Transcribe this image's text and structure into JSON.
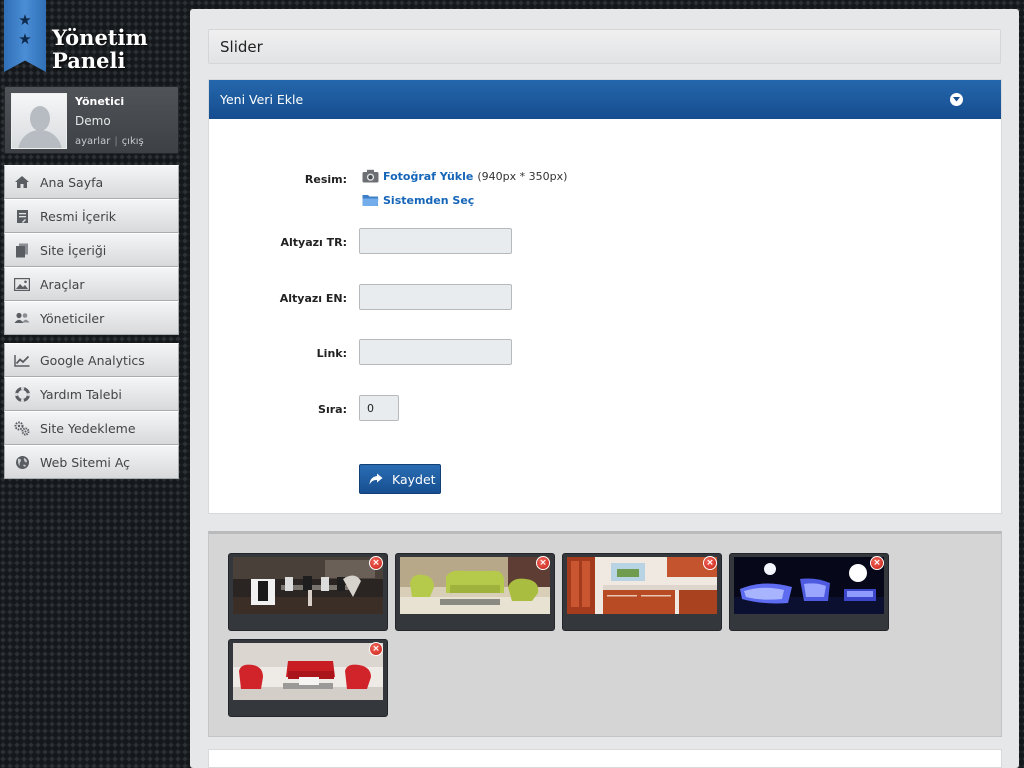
{
  "brand": {
    "line1": "Yönetim",
    "line2": "Paneli"
  },
  "user": {
    "role": "Yönetici",
    "name": "Demo",
    "settings_link": "ayarlar",
    "separator": "|",
    "logout_link": "çıkış"
  },
  "nav_primary": [
    {
      "label": "Ana Sayfa",
      "icon": "home-icon"
    },
    {
      "label": "Resmi İçerik",
      "icon": "document-icon"
    },
    {
      "label": "Site İçeriği",
      "icon": "pages-icon"
    },
    {
      "label": "Araçlar",
      "icon": "image-icon"
    },
    {
      "label": "Yöneticiler",
      "icon": "users-icon"
    }
  ],
  "nav_secondary": [
    {
      "label": "Google Analytics",
      "icon": "chart-icon"
    },
    {
      "label": "Yardım Talebi",
      "icon": "lifebuoy-icon"
    },
    {
      "label": "Site Yedekleme",
      "icon": "gears-icon"
    },
    {
      "label": "Web Sitemi Aç",
      "icon": "globe-icon"
    }
  ],
  "page": {
    "title": "Slider"
  },
  "form": {
    "header": "Yeni Veri Ekle",
    "image_label": "Resim:",
    "upload_link": "Fotoğraf Yükle",
    "upload_hint": "(940px * 350px)",
    "system_link": "Sistemden Seç",
    "caption_tr_label": "Altyazı TR:",
    "caption_tr_value": "",
    "caption_en_label": "Altyazı EN:",
    "caption_en_value": "",
    "link_label": "Link:",
    "link_value": "",
    "order_label": "Sıra:",
    "order_value": "0",
    "save_label": "Kaydet"
  },
  "gallery": {
    "delete_glyph": "×",
    "images": [
      {
        "name": "slider-image-dining-room"
      },
      {
        "name": "slider-image-green-sofa"
      },
      {
        "name": "slider-image-kitchen"
      },
      {
        "name": "slider-image-glowing-furniture"
      },
      {
        "name": "slider-image-red-armchairs"
      }
    ]
  },
  "colors": {
    "accent": "#1b5aa0",
    "link": "#1565b8",
    "delete": "#d4281b"
  }
}
